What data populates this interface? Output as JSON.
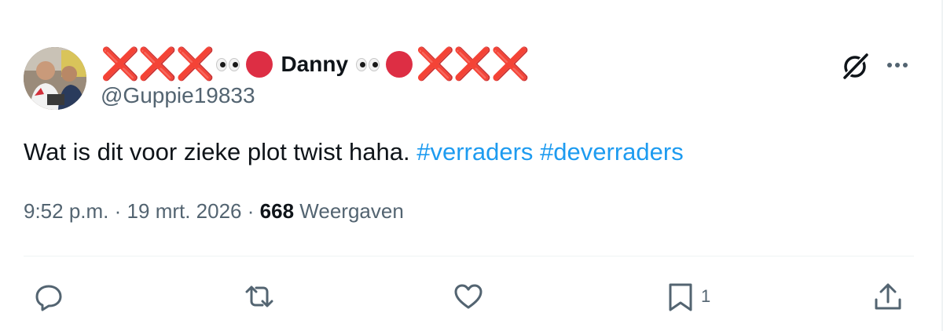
{
  "author": {
    "prefix_marks": [
      "❌",
      "❌",
      "❌"
    ],
    "display_name": "Danny",
    "suffix_marks": [
      "❌",
      "❌",
      "❌"
    ],
    "handle": "@Guppie19833"
  },
  "tweet": {
    "text": "Wat is dit voor zieke plot twist haha.",
    "hashtags": [
      "#verraders",
      "#deverraders"
    ]
  },
  "meta": {
    "time": "9:52 p.m.",
    "separator": "·",
    "date": "19 mrt. 2026",
    "views_count": "668",
    "views_label": "Weergaven"
  },
  "actions": {
    "reply_icon": "reply-icon",
    "repost_icon": "repost-icon",
    "like_icon": "heart-icon",
    "bookmark_icon": "bookmark-icon",
    "bookmark_count": "1",
    "share_icon": "share-icon"
  },
  "colors": {
    "accent": "#1d9bf0",
    "secondary_text": "#536471",
    "divider": "#eff3f4",
    "red_mark": "#d0323f"
  }
}
